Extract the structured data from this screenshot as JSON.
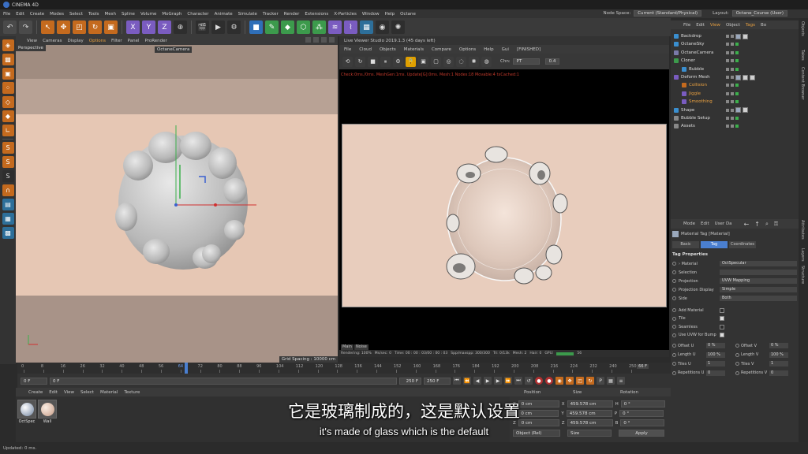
{
  "app": {
    "title": "CINEMA 4D"
  },
  "menubar": {
    "items": [
      "File",
      "Edit",
      "Create",
      "Modes",
      "Select",
      "Tools",
      "Mesh",
      "Spline",
      "Volume",
      "MoGraph",
      "Character",
      "Animate",
      "Simulate",
      "Tracker",
      "Render",
      "Extensions",
      "X-Particles",
      "Window",
      "Help",
      "Octane"
    ],
    "node_space_label": "Node Space:",
    "node_space_value": "Current (Standard/Physical)",
    "layout_label": "Layout:",
    "layout_value": "Octane_Course (User)"
  },
  "viewport": {
    "menu": [
      "View",
      "Cameras",
      "Display",
      "Options",
      "Filter",
      "Panel",
      "ProRender"
    ],
    "name": "Perspective",
    "camera": "OctaneCamera",
    "grid_spacing": "Grid Spacing : 10000 cm"
  },
  "live_viewer": {
    "title": "Live Viewer Studio 2019.1.3 (45 days left)",
    "menu": [
      "File",
      "Cloud",
      "Objects",
      "Materials",
      "Compare",
      "Options",
      "Help",
      "Gui",
      "[FINISHED]"
    ],
    "channel_label": "Chn:",
    "channel_value": "PT",
    "zoom_value": "0.4",
    "status_line": "Check:0ms./0ms. MeshGen:1ms. Update[G]:0ms. Mesh:1 Nodes:18 Movable:4 txCached:1",
    "tabs": [
      "Main",
      "Noise"
    ],
    "stats": [
      "Rendering: 100%",
      "Ms/sec: 0",
      "Time: 00 : 00 : 03/00 : 00 : 03",
      "Spp/maxspp: 300/300",
      "Tri: 0/13k",
      "Mesh: 2",
      "Hair: 0",
      "GPU:",
      "56"
    ]
  },
  "timeline": {
    "ticks": [
      "0",
      "8",
      "16",
      "26",
      "32",
      "40",
      "48",
      "56",
      "64",
      "72",
      "80",
      "88",
      "96",
      "104",
      "112",
      "120",
      "128",
      "136",
      "144",
      "152",
      "160",
      "168",
      "176",
      "184",
      "192",
      "200",
      "208",
      "216",
      "224",
      "232",
      "240",
      "250"
    ],
    "current": "64",
    "end_label": "66 F"
  },
  "transport": {
    "start_field": "0 F",
    "current_field": "0 F",
    "end_field": "250 F",
    "end_field2": "250 F"
  },
  "materials": {
    "menu": [
      "Create",
      "Edit",
      "View",
      "Select",
      "Material",
      "Texture"
    ],
    "items": [
      {
        "label": "OctSpec",
        "color": "#b8c4d4"
      },
      {
        "label": "Wall",
        "color": "#e2c2b0"
      }
    ]
  },
  "coordinates": {
    "headers": [
      "Position",
      "Size",
      "Rotation"
    ],
    "rows": [
      {
        "axis": "X",
        "pos": "0 cm",
        "size": "459.578 cm",
        "rot_axis": "H",
        "rot": "0 °"
      },
      {
        "axis": "Y",
        "pos": "0 cm",
        "size": "459.578 cm",
        "rot_axis": "P",
        "rot": "0 °"
      },
      {
        "axis": "Z",
        "pos": "0 cm",
        "size": "459.578 cm",
        "rot_axis": "B",
        "rot": "0 °"
      }
    ],
    "mode": "Object (Rel)",
    "size_mode": "Size",
    "apply": "Apply"
  },
  "object_manager": {
    "menu": [
      "File",
      "Edit",
      "View",
      "Object",
      "Tags",
      "Bo"
    ],
    "objects": [
      {
        "name": "Backdrop",
        "color": "#3a8fd0",
        "indent": 0
      },
      {
        "name": "OctaneSky",
        "color": "#3a8fd0",
        "indent": 0
      },
      {
        "name": "OctaneCamera",
        "color": "#7a7aaa",
        "indent": 0
      },
      {
        "name": "Cloner",
        "color": "#3c9a4c",
        "indent": 0
      },
      {
        "name": "Bubble",
        "color": "#3a8fd0",
        "indent": 1
      },
      {
        "name": "Deform Mesh",
        "color": "#7a5cc0",
        "indent": 0
      },
      {
        "name": "Collision",
        "color": "#c46a1e",
        "indent": 1
      },
      {
        "name": "Jiggle",
        "color": "#7a5cc0",
        "indent": 1
      },
      {
        "name": "Smoothing",
        "color": "#7a5cc0",
        "indent": 1
      },
      {
        "name": "Shape",
        "color": "#3a8fd0",
        "indent": 0
      },
      {
        "name": "Bubble Setup",
        "color": "#888888",
        "indent": 0
      },
      {
        "name": "Assets",
        "color": "#888888",
        "indent": 0
      }
    ]
  },
  "attribute_manager": {
    "menu": [
      "Mode",
      "Edit",
      "User Da"
    ],
    "header": "Material Tag [Material]",
    "tabs": [
      "Basic",
      "Tag",
      "Coordinates"
    ],
    "active_tab": "Tag",
    "section": "Tag Properties",
    "rows": [
      {
        "label": "› Material",
        "value": "OctSpecular"
      },
      {
        "label": "Selection",
        "value": ""
      },
      {
        "label": "Projection",
        "value": "UVW Mapping"
      },
      {
        "label": "Projection Display",
        "value": "Simple"
      },
      {
        "label": "Side",
        "value": "Both"
      }
    ],
    "checks": [
      {
        "label": "Add Material",
        "on": false
      },
      {
        "label": "Tile",
        "on": true
      },
      {
        "label": "Seamless",
        "on": false
      },
      {
        "label": "Use UVW for Bump",
        "on": true
      }
    ],
    "pairs": [
      {
        "l1": "Offset U",
        "v1": "0 %",
        "l2": "Offset V",
        "v2": "0 %"
      },
      {
        "l1": "Length U",
        "v1": "100 %",
        "l2": "Length V",
        "v2": "100 %"
      },
      {
        "l1": "Tiles U",
        "v1": "1",
        "l2": "Tiles V",
        "v2": "1"
      },
      {
        "l1": "Repetitions U",
        "v1": "0",
        "l2": "Repetitions V",
        "v2": "0"
      }
    ]
  },
  "side_tabs": [
    "Objects",
    "Takes",
    "Content Browser",
    "Attributes",
    "Layers",
    "Structure"
  ],
  "status": "Updated: 0 ms.",
  "subtitles": {
    "zh": "它是玻璃制成的，这是默认设置",
    "en": "it's made of glass which is the default"
  }
}
